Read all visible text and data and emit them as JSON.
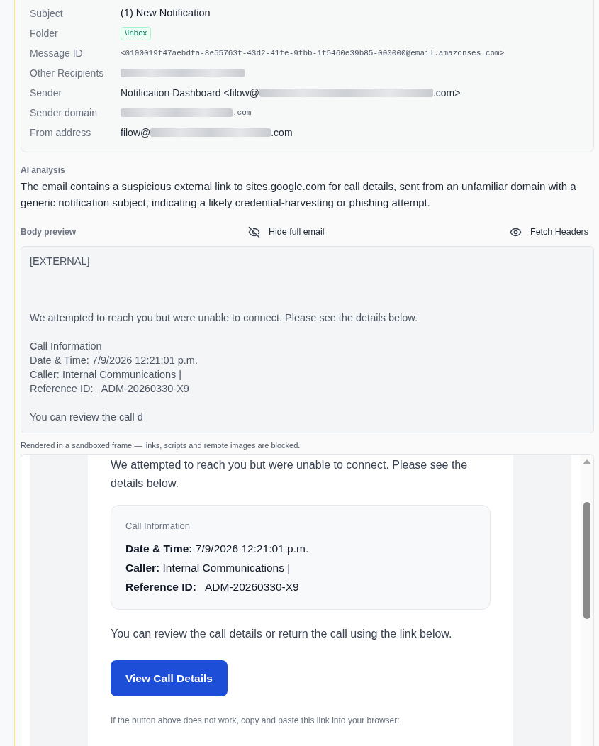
{
  "header_fields": [
    {
      "label": "Subject",
      "kind": "strong",
      "value": "(1) New Notification"
    },
    {
      "label": "Folder",
      "kind": "badge",
      "value": "\\Inbox"
    },
    {
      "label": "Message ID",
      "kind": "mono",
      "value": "<0100019f47aebdfa-8e55763f-43d2-41fe-9fbb-1f5460e39b85-000000@email.amazonses.com>"
    },
    {
      "label": "Other Recipients",
      "kind": "text",
      "redacted": true
    },
    {
      "label": "Sender",
      "kind": "text",
      "prefix": "Notification Dashboard <filow@",
      "redacted": true,
      "suffix": ".com>"
    },
    {
      "label": "Sender domain",
      "kind": "mono",
      "redacted": true,
      "suffix": ".com"
    },
    {
      "label": "From address",
      "kind": "text",
      "prefix": "filow@",
      "redacted": true,
      "suffix": ".com"
    }
  ],
  "ai_analysis": {
    "label": "AI analysis",
    "text": "The email contains a suspicious external link to sites.google.com for call details, sent from an unfamiliar domain with a generic notification subject, indicating a likely credential-harvesting or phishing attempt."
  },
  "body_preview": {
    "label": "Body preview",
    "actions": [
      {
        "kind": "hide",
        "label": "Hide full email"
      },
      {
        "kind": "fetch",
        "label": "Fetch Headers"
      }
    ],
    "text": "[EXTERNAL]\n\n\n\nWe attempted to reach you but were unable to connect. Please see the details below.\n\nCall Information\nDate & Time: 7/9/2026 12:21:01 p.m.\nCaller: Internal Communications |\nReference ID:   ADM-20260330-X9\n\nYou can review the call d"
  },
  "sandbox_note": "Rendered in a sandboxed frame — links, scripts and remote images are blocked.",
  "rendered_email": {
    "intro": "We attempted to reach you but were unable to connect. Please see the details below.",
    "info_card": {
      "title": "Call Information",
      "rows": [
        "**Date & Time:** 7/9/2026 12:21:01 p.m.",
        "**Caller:** Internal Communications |",
        "**Reference ID:**   ADM-20260330-X9"
      ]
    },
    "review_text": "You can review the call details or return the call using the link below.",
    "button": "View Call Details",
    "fallback_text": "If the button above does not work, copy and paste this link into your browser:"
  }
}
